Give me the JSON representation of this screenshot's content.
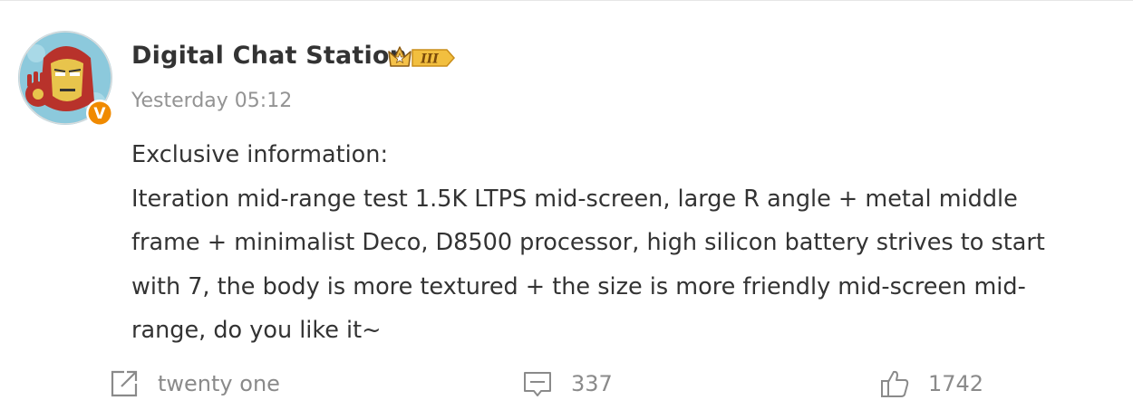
{
  "post": {
    "author": "Digital Chat Station",
    "badge_text": "III",
    "verified_mark": "V",
    "timestamp": "Yesterday 05:12",
    "content_lines": [
      "Exclusive information:",
      "Iteration mid-range test 1.5K LTPS mid-screen, large R angle + metal middle",
      "frame + minimalist Deco, D8500 processor, high silicon battery strives to start",
      "with 7, the body is more textured + the size is more friendly mid-screen mid-",
      "range, do you like it~"
    ]
  },
  "actions": {
    "repost": {
      "icon": "share-icon",
      "label": "twenty one"
    },
    "comment": {
      "icon": "comment-icon",
      "label": "337"
    },
    "like": {
      "icon": "thumbs-up-icon",
      "label": "1742"
    }
  },
  "colors": {
    "text": "#333333",
    "muted": "#939393",
    "action": "#8a8a8a",
    "verified": "#f08a00",
    "badge_gold": "#f5c24a"
  }
}
